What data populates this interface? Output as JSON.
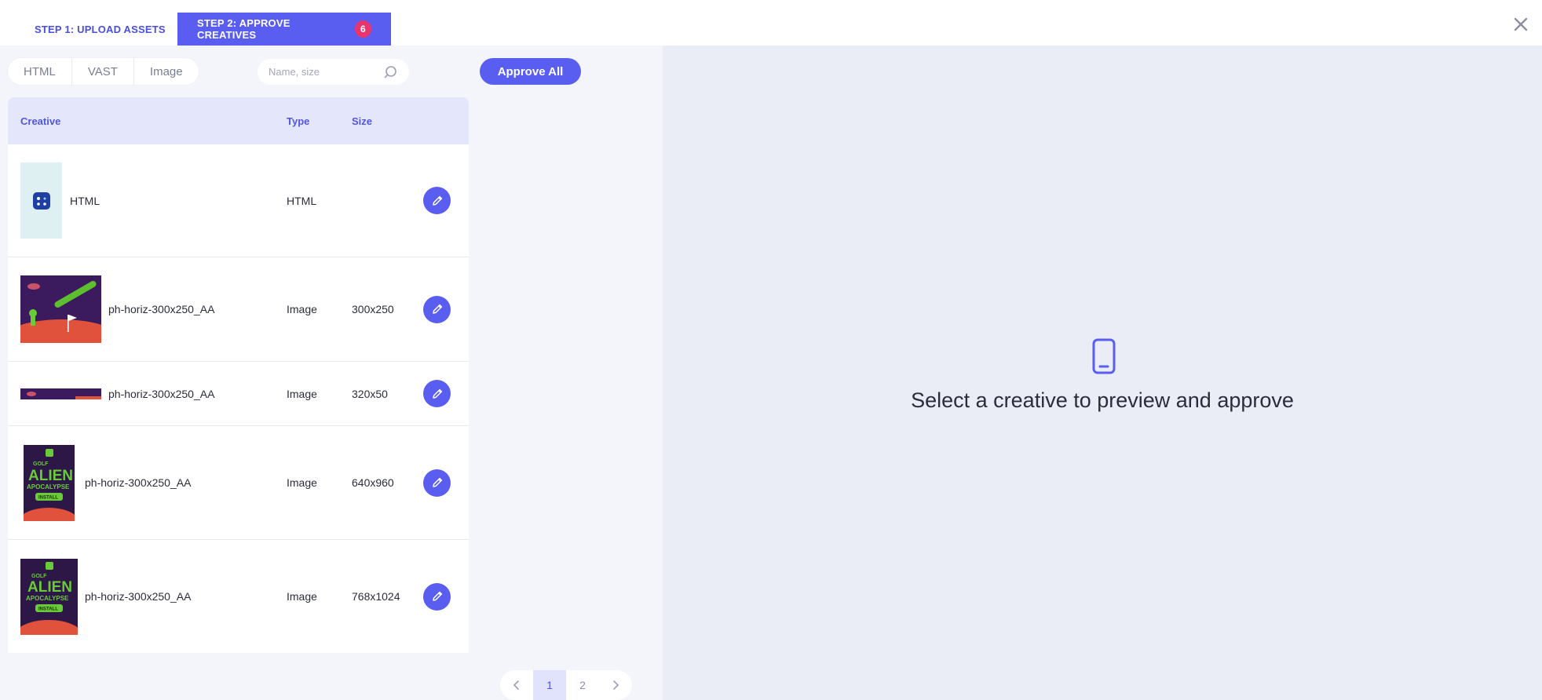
{
  "tabs": [
    {
      "label": "STEP 1: UPLOAD ASSETS"
    },
    {
      "label": "STEP 2: APPROVE CREATIVES",
      "badge": "6"
    }
  ],
  "close_icon": "close-icon",
  "filters": [
    "HTML",
    "VAST",
    "Image"
  ],
  "search": {
    "placeholder": "Name, size",
    "icon": "search-icon"
  },
  "approve_all_label": "Approve All",
  "table": {
    "headers": {
      "creative": "Creative",
      "type": "Type",
      "size": "Size"
    },
    "rows": [
      {
        "name": "HTML",
        "type": "HTML",
        "size": ""
      },
      {
        "name": "ph-horiz-300x250_AA",
        "type": "Image",
        "size": "300x250"
      },
      {
        "name": "ph-horiz-300x250_AA",
        "type": "Image",
        "size": "320x50"
      },
      {
        "name": "ph-horiz-300x250_AA",
        "type": "Image",
        "size": "640x960"
      },
      {
        "name": "ph-horiz-300x250_AA",
        "type": "Image",
        "size": "768x1024"
      }
    ]
  },
  "thumb_text": {
    "golf": "GOLF",
    "alien": "ALIEN",
    "apocalypse": "APOCALYPSE",
    "install": "INSTALL"
  },
  "pagination": {
    "prev_icon": "chevron-left-icon",
    "pages": [
      "1",
      "2"
    ],
    "current": "1",
    "next_icon": "chevron-right-icon"
  },
  "preview": {
    "icon": "phone-icon",
    "message": "Select a creative to preview and approve"
  },
  "colors": {
    "accent": "#5a5ef0",
    "badge": "#e8356e",
    "header_bg": "#e4e6fb",
    "preview_bg": "#eaecf6"
  }
}
